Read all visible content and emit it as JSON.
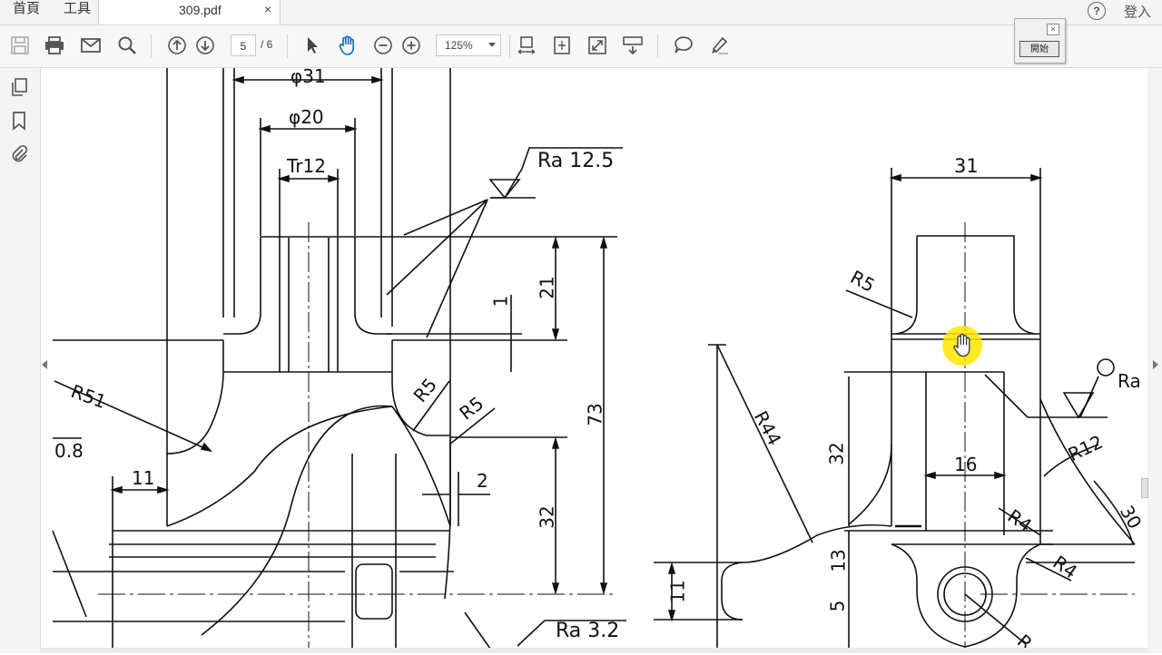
{
  "menu": {
    "home": "首頁",
    "tools": "工具"
  },
  "tab": {
    "title": "309.pdf",
    "close": "×"
  },
  "header": {
    "help": "?",
    "login": "登入"
  },
  "toolbar": {
    "page_current": "5",
    "page_total": "/ 6",
    "zoom": "125%",
    "icons": [
      "save-icon",
      "print-icon",
      "email-icon",
      "search-icon",
      "page-up-icon",
      "page-down-icon",
      "select-icon",
      "hand-icon",
      "zoom-out-icon",
      "zoom-in-icon",
      "fit-width-icon",
      "fit-page-icon",
      "fullscreen-icon",
      "scroll-mode-icon",
      "comment-icon",
      "highlight-icon"
    ]
  },
  "left_panel": {
    "icons": [
      "pages-icon",
      "bookmark-icon",
      "attachment-icon"
    ]
  },
  "float_panel": {
    "button": "開始",
    "close": "×"
  },
  "accent": {
    "hand_tool": "#1a73c9",
    "cursor_highlight": "#ffe600"
  },
  "drawing": {
    "labels": {
      "phi31": "φ31",
      "phi20": "φ20",
      "tr12": "Tr12",
      "ra_top": "Ra 12.5",
      "ra_bottom": "Ra 3.2",
      "d21": "21",
      "d1": "1",
      "d73": "73",
      "d32_mid": "32",
      "d2": "2",
      "r51": "R51",
      "v08": "0.8",
      "d11_left": "11",
      "r5_a": "R5",
      "r5_b": "R5",
      "d31": "31",
      "r5_right": "R5",
      "r44": "R44",
      "d32_right": "32",
      "d16": "16",
      "r12": "R12",
      "r4_a": "R4",
      "r4_b": "R4",
      "d13": "13",
      "d5": "5",
      "d11_right": "11",
      "ra_right": "Ra",
      "d30": "30",
      "r_bottom": "R"
    }
  }
}
